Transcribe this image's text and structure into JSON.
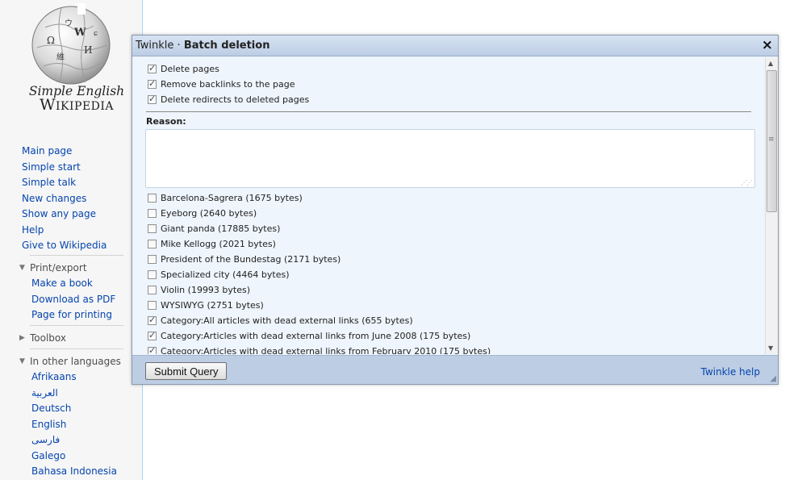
{
  "logo": {
    "line1": "Simple English",
    "line2_big": "W",
    "line2_small": "IKIPEDIA"
  },
  "nav": [
    "Main page",
    "Simple start",
    "Simple talk",
    "New changes",
    "Show any page",
    "Help",
    "Give to Wikipedia"
  ],
  "print_export": {
    "heading": "Print/export",
    "items": [
      "Make a book",
      "Download as PDF",
      "Page for printing"
    ]
  },
  "toolbox": {
    "heading": "Toolbox"
  },
  "languages": {
    "heading": "In other languages",
    "items": [
      "Afrikaans",
      "العربية",
      "Deutsch",
      "English",
      "فارسی",
      "Galego",
      "Bahasa Indonesia"
    ]
  },
  "dialog": {
    "title_prefix": "Twinkle · ",
    "title": "Batch deletion",
    "close_glyph": "×",
    "options": [
      {
        "label": "Delete pages",
        "checked": true
      },
      {
        "label": "Remove backlinks to the page",
        "checked": true
      },
      {
        "label": "Delete redirects to deleted pages",
        "checked": true
      }
    ],
    "reason_label": "Reason:",
    "reason_value": "",
    "pages": [
      {
        "label": "Barcelona-Sagrera (1675 bytes)",
        "checked": false
      },
      {
        "label": "Eyeborg (2640 bytes)",
        "checked": false
      },
      {
        "label": "Giant panda (17885 bytes)",
        "checked": false
      },
      {
        "label": "Mike Kellogg (2021 bytes)",
        "checked": false
      },
      {
        "label": "President of the Bundestag (2171 bytes)",
        "checked": false
      },
      {
        "label": "Specialized city (4464 bytes)",
        "checked": false
      },
      {
        "label": "Violin (19993 bytes)",
        "checked": false
      },
      {
        "label": "WYSIWYG (2751 bytes)",
        "checked": false
      },
      {
        "label": "Category:All articles with dead external links (655 bytes)",
        "checked": true
      },
      {
        "label": "Category:Articles with dead external links from June 2008 (175 bytes)",
        "checked": true
      },
      {
        "label": "Category:Articles with dead external links from February 2010 (175 bytes)",
        "checked": true
      }
    ],
    "submit_label": "Submit Query",
    "help_label": "Twinkle help"
  }
}
